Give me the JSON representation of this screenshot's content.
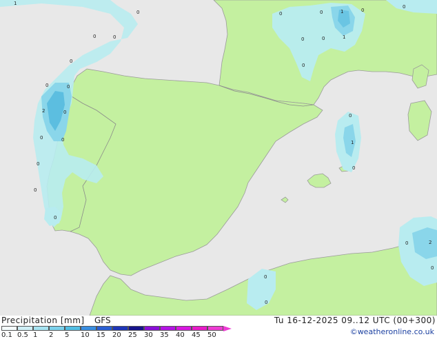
{
  "map": {
    "contour_labels": [
      {
        "text": "1"
      },
      {
        "text": "0"
      },
      {
        "text": "0"
      },
      {
        "text": "0"
      },
      {
        "text": "0"
      },
      {
        "text": "0"
      },
      {
        "text": "1"
      },
      {
        "text": "0"
      },
      {
        "text": "0"
      },
      {
        "text": "0"
      },
      {
        "text": "1"
      },
      {
        "text": "0"
      },
      {
        "text": "0"
      },
      {
        "text": "0"
      },
      {
        "text": "2"
      },
      {
        "text": "0"
      },
      {
        "text": "0"
      },
      {
        "text": "0"
      },
      {
        "text": "0"
      },
      {
        "text": "0"
      },
      {
        "text": "0"
      },
      {
        "text": "0"
      },
      {
        "text": "1"
      },
      {
        "text": "0"
      },
      {
        "text": "0"
      },
      {
        "text": "2"
      },
      {
        "text": "0"
      },
      {
        "text": "0"
      },
      {
        "text": "0"
      }
    ],
    "colors": {
      "sea": "#e8e8e8",
      "land": "#c4f0a0",
      "border": "#8a8a8a",
      "precip_light": "#b8ecf0",
      "precip_mid": "#8ad6ea",
      "precip_strong": "#5cbee0"
    }
  },
  "footer": {
    "title": "Precipitation [mm]",
    "model": "GFS",
    "valid_time": "Tu 16-12-2025 09..12 UTC (00+300)",
    "credit": "©weatheronline.co.uk",
    "scale_labels": [
      "0.1",
      "0.5",
      "1",
      "2",
      "5",
      "10",
      "15",
      "20",
      "25",
      "30",
      "35",
      "40",
      "45",
      "50"
    ],
    "scale_colors": [
      "#f4fcfd",
      "#cfeff6",
      "#a6e3f1",
      "#7cd2ec",
      "#52bfe4",
      "#3a8ee0",
      "#2a5fd4",
      "#1f36b8",
      "#16148c",
      "#8a0ed8",
      "#b414e4",
      "#d818e0",
      "#e81cc8",
      "#ee3cd4"
    ]
  }
}
